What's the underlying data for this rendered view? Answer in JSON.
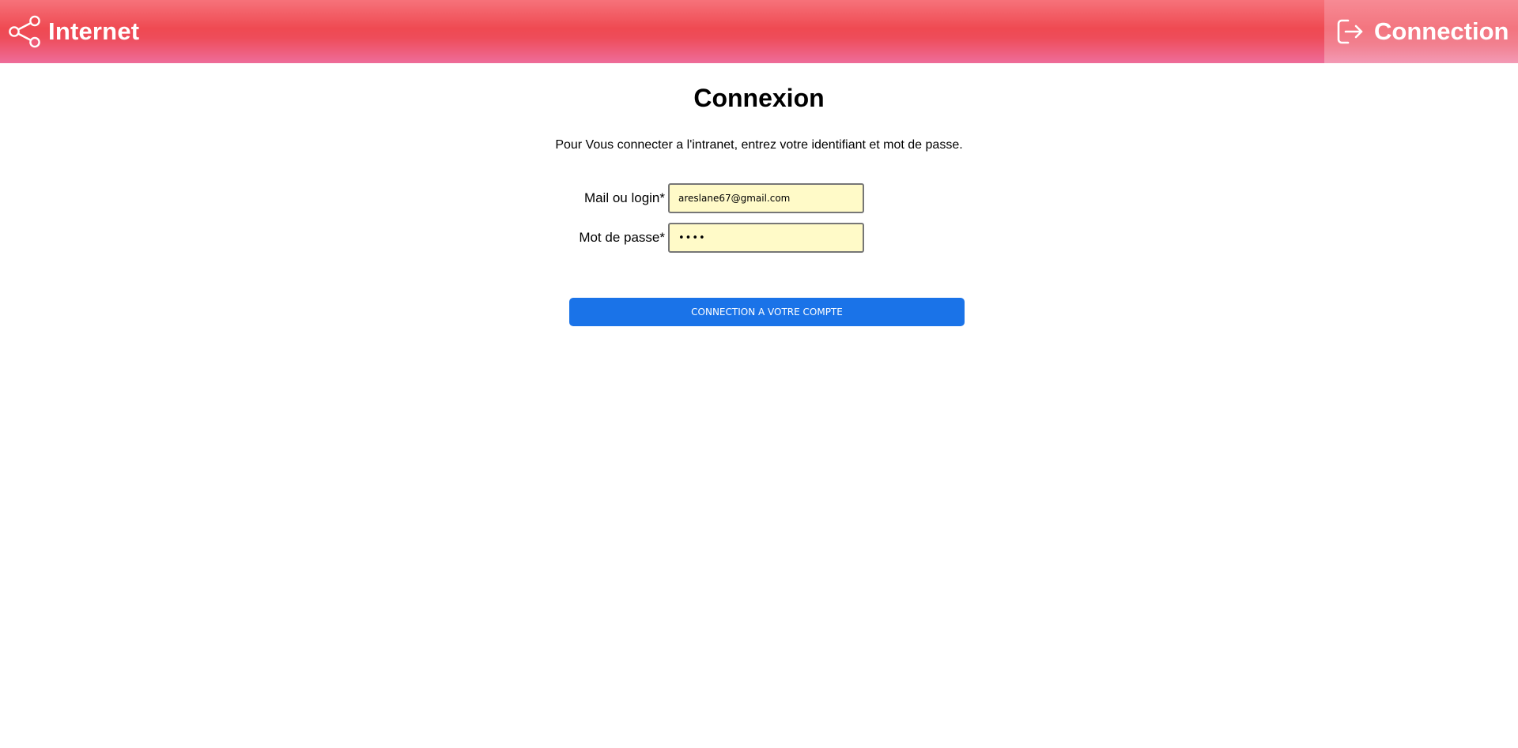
{
  "header": {
    "brand_label": "Internet",
    "brand_icon": "share-icon",
    "login_label": "Connection",
    "login_icon": "sign-in-icon",
    "gradient_colors": [
      "#f6727a",
      "#ef4a52",
      "#ee6c9a"
    ]
  },
  "main": {
    "title": "Connexion",
    "intro": "Pour Vous connecter a l'intranet, entrez votre identifiant et mot de passe.",
    "login_field": {
      "label": "Mail ou login*",
      "value": "areslane67@gmail.com"
    },
    "password_field": {
      "label": "Mot de passe*",
      "value": "••••"
    },
    "submit_label": "CONNECTION A VOTRE COMPTE",
    "submit_color": "#1a73e8",
    "input_background": "#fffac8"
  }
}
